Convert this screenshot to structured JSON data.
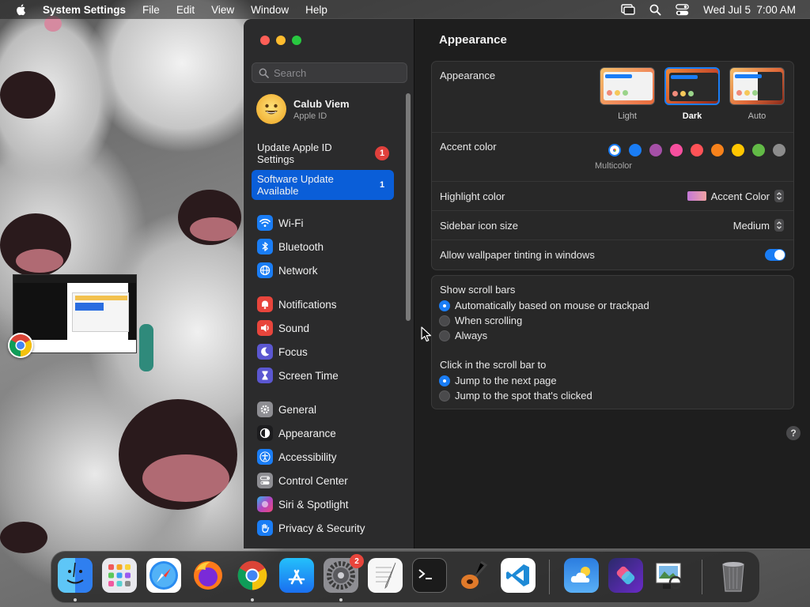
{
  "menubar": {
    "app_name": "System Settings",
    "menus": [
      "File",
      "Edit",
      "View",
      "Window",
      "Help"
    ],
    "clock": "Wed Jul 5  7:00 AM",
    "icons": [
      "screen-mirroring-icon",
      "spotlight-search-icon",
      "control-center-icon"
    ]
  },
  "sidebar": {
    "search_placeholder": "Search",
    "profile": {
      "name": "Calub Viem",
      "subtitle": "Apple ID"
    },
    "notices": [
      {
        "label": "Update Apple ID Settings",
        "badge": "1",
        "selected": false
      },
      {
        "label": "Software Update Available",
        "badge": "1",
        "selected": true
      }
    ],
    "groups": [
      [
        {
          "label": "Wi-Fi",
          "icon": "wifi-icon",
          "color": "#1a7df5"
        },
        {
          "label": "Bluetooth",
          "icon": "bluetooth-icon",
          "color": "#1a7df5"
        },
        {
          "label": "Network",
          "icon": "globe-icon",
          "color": "#1a7df5"
        }
      ],
      [
        {
          "label": "Notifications",
          "icon": "bell-icon",
          "color": "#e8453c"
        },
        {
          "label": "Sound",
          "icon": "speaker-icon",
          "color": "#e8453c"
        },
        {
          "label": "Focus",
          "icon": "moon-icon",
          "color": "#5b57d1"
        },
        {
          "label": "Screen Time",
          "icon": "hourglass-icon",
          "color": "#5b57d1"
        }
      ],
      [
        {
          "label": "General",
          "icon": "gear-icon",
          "color": "#8e8e93"
        },
        {
          "label": "Appearance",
          "icon": "appearance-icon",
          "color": "#1c1c1e"
        },
        {
          "label": "Accessibility",
          "icon": "accessibility-icon",
          "color": "#1a7df5"
        },
        {
          "label": "Control Center",
          "icon": "control-center-icon",
          "color": "#8e8e93"
        },
        {
          "label": "Siri & Spotlight",
          "icon": "siri-icon",
          "color": "#b146c2"
        },
        {
          "label": "Privacy & Security",
          "icon": "hand-icon",
          "color": "#1a7df5"
        }
      ]
    ]
  },
  "main": {
    "title": "Appearance",
    "appearance": {
      "label": "Appearance",
      "options": [
        {
          "label": "Light",
          "selected": false
        },
        {
          "label": "Dark",
          "selected": true
        },
        {
          "label": "Auto",
          "selected": false
        }
      ]
    },
    "accent": {
      "label": "Accent color",
      "multicolor_label": "Multicolor",
      "colors": [
        "#ffffff",
        "#1a7df5",
        "#a550a7",
        "#f74f9e",
        "#ff5257",
        "#f7821b",
        "#ffc600",
        "#62ba46",
        "#8c8c8c"
      ]
    },
    "highlight": {
      "label": "Highlight color",
      "value": "Accent Color"
    },
    "icon_size": {
      "label": "Sidebar icon size",
      "value": "Medium"
    },
    "tinting": {
      "label": "Allow wallpaper tinting in windows",
      "enabled": true
    },
    "scroll_bars": {
      "title": "Show scroll bars",
      "options": [
        {
          "label": "Automatically based on mouse or trackpad",
          "selected": true
        },
        {
          "label": "When scrolling",
          "selected": false
        },
        {
          "label": "Always",
          "selected": false
        }
      ]
    },
    "click_scroll": {
      "title": "Click in the scroll bar to",
      "options": [
        {
          "label": "Jump to the next page",
          "selected": true
        },
        {
          "label": "Jump to the spot that's clicked",
          "selected": false
        }
      ]
    },
    "help": "?"
  },
  "dock": {
    "apps": [
      {
        "name": "finder-icon",
        "running": true
      },
      {
        "name": "launchpad-icon",
        "running": false
      },
      {
        "name": "safari-icon",
        "running": false
      },
      {
        "name": "firefox-icon",
        "running": false
      },
      {
        "name": "chrome-icon",
        "running": true
      },
      {
        "name": "app-store-icon",
        "running": false
      },
      {
        "name": "system-settings-icon",
        "running": true,
        "badge": "2"
      },
      {
        "name": "textedit-icon",
        "running": false
      },
      {
        "name": "terminal-icon",
        "running": false
      },
      {
        "name": "garageband-icon",
        "running": false
      },
      {
        "name": "vscode-icon",
        "running": false
      },
      {
        "name": "weather-icon",
        "running": false
      },
      {
        "name": "shortcuts-icon",
        "running": false
      },
      {
        "name": "preview-icon",
        "running": false
      },
      {
        "name": "trash-icon",
        "running": false
      }
    ]
  }
}
